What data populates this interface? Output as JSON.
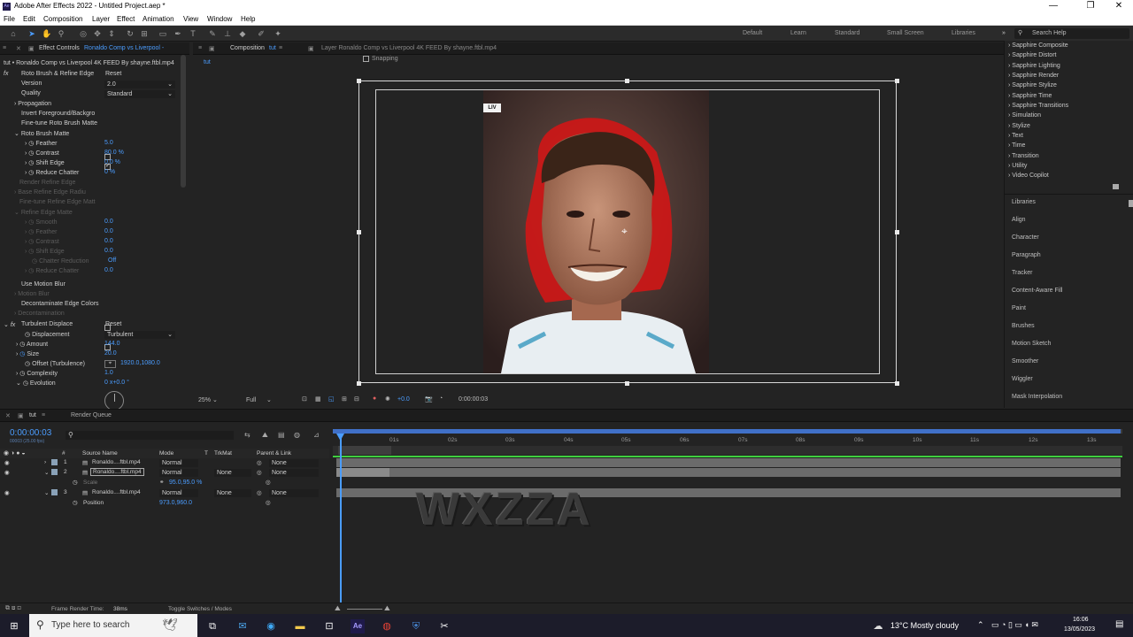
{
  "window": {
    "title": "Adobe After Effects 2022 - Untitled Project.aep *",
    "icon": "Ae"
  },
  "menu": [
    "File",
    "Edit",
    "Composition",
    "Layer",
    "Effect",
    "Animation",
    "View",
    "Window",
    "Help"
  ],
  "toolbar": {
    "snapping_label": "Snapping",
    "workspaces": [
      "Default",
      "Learn",
      "Standard",
      "Small Screen",
      "Libraries"
    ],
    "search_help": "Search Help"
  },
  "effect_controls": {
    "tab_label": "Effect Controls",
    "tab_target": "Ronaldo Comp vs Liverpool -",
    "layer_path": "tut • Ronaldo Comp vs Liverpool 4K FEED By shayne.ftbl.mp4",
    "roto": {
      "name": "Roto Brush & Refine Edge",
      "reset": "Reset",
      "version_label": "Version",
      "version_value": "2.0",
      "quality_label": "Quality",
      "quality_value": "Standard",
      "propagation": "Propagation",
      "invert": "Invert Foreground/Backgro",
      "finetune": "Fine-tune Roto Brush Matte",
      "matte_group": "Roto Brush Matte",
      "feather_label": "Feather",
      "feather_value": "5.0",
      "contrast_label": "Contrast",
      "contrast_value": "80.0 %",
      "shift_label": "Shift Edge",
      "shift_value": "0.0 %",
      "chatter_label": "Reduce Chatter",
      "chatter_value": "0 %",
      "disabled": [
        "Render Refine Edge",
        "Base Refine Edge Radiu",
        "Fine-tune Refine Edge Matt",
        "Refine Edge Matte",
        "Smooth",
        "Feather",
        "Contrast",
        "Shift Edge",
        "Chatter Reduction",
        "Reduce Chatter"
      ],
      "disabled_vals": [
        "",
        "",
        "",
        "",
        "0.0",
        "0.0",
        "0.0",
        "0.0",
        "Off",
        "0.0"
      ],
      "motion_blur": "Use Motion Blur",
      "motion_blur_sub": "Motion Blur",
      "decontaminate": "Decontaminate Edge Colors",
      "decontamination": "Decontamination"
    },
    "turb": {
      "name": "Turbulent Displace",
      "reset": "Reset",
      "disp_label": "Displacement",
      "disp_value": "Turbulent",
      "amount_label": "Amount",
      "amount_value": "144.0",
      "size_label": "Size",
      "size_value": "20.0",
      "offset_label": "Offset (Turbulence)",
      "offset_value": "1920.0,1080.0",
      "complexity_label": "Complexity",
      "complexity_value": "1.0",
      "evolution_label": "Evolution",
      "evolution_value": "0 x+0.0 °"
    }
  },
  "composition": {
    "tab_label": "Composition",
    "tab_name": "tut",
    "layer_tab": "Layer  Ronaldo Comp vs Liverpool 4K FEED By shayne.ftbl.mp4",
    "crumb": "tut",
    "badge": "LIV",
    "zoom": "25%",
    "resolution": "Full",
    "exposure": "+0.0",
    "timecode": "0:00:00:03"
  },
  "effects_presets": [
    "Sapphire Composite",
    "Sapphire Distort",
    "Sapphire Lighting",
    "Sapphire Render",
    "Sapphire Stylize",
    "Sapphire Time",
    "Sapphire Transitions",
    "Simulation",
    "Stylize",
    "Text",
    "Time",
    "Transition",
    "Utility",
    "Video Copilot"
  ],
  "right_panels": [
    "Libraries",
    "Align",
    "Character",
    "Paragraph",
    "Tracker",
    "Content-Aware Fill",
    "Paint",
    "Brushes",
    "Motion Sketch",
    "Smoother",
    "Wiggler",
    "Mask Interpolation"
  ],
  "timeline": {
    "tab": "tut",
    "render_queue": "Render Queue",
    "timecode": "0:00:00:03",
    "sub_timecode": "00003 (25.00 fps)",
    "cols": {
      "num": "#",
      "source": "Source Name",
      "mode": "Mode",
      "t": "T",
      "trkmat": "TrkMat",
      "parent": "Parent & Link"
    },
    "layers": [
      {
        "num": "1",
        "name": "Ronaldo....ftbl.mp4",
        "mode": "Normal",
        "trkmat": "",
        "parent": "None"
      },
      {
        "num": "2",
        "name": "Ronaldo....ftbl.mp4",
        "mode": "Normal",
        "trkmat": "None",
        "parent": "None"
      },
      {
        "num": "3",
        "name": "Ronaldo....ftbl.mp4",
        "mode": "Normal",
        "trkmat": "None",
        "parent": "None"
      }
    ],
    "scale_label": "Scale",
    "scale_value": "95.0,95.0 %",
    "position_label": "Position",
    "position_value": "973.0,960.0",
    "ruler": [
      "01s",
      "02s",
      "03s",
      "04s",
      "05s",
      "06s",
      "07s",
      "08s",
      "09s",
      "10s",
      "11s",
      "12s",
      "13s"
    ],
    "render_time_label": "Frame Render Time:",
    "render_time_value": "38ms",
    "toggle": "Toggle Switches / Modes",
    "watermark": "WXZZA"
  },
  "taskbar": {
    "search": "Type here to search",
    "weather": "13°C  Mostly cloudy",
    "time": "16:06",
    "date": "13/05/2023"
  }
}
